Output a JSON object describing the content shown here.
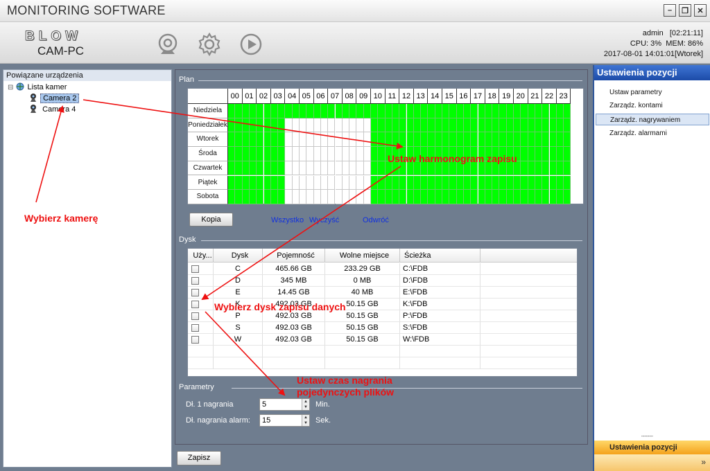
{
  "window": {
    "title": "MONITORING SOFTWARE",
    "minimize_label": "–",
    "restore_label": "❐",
    "close_label": "✕"
  },
  "header": {
    "brand": "BLOW",
    "product": "CAM-PC",
    "icons": [
      "camera-icon",
      "gear-icon",
      "play-icon"
    ],
    "user": "admin",
    "elapsed": "[02:21:11]",
    "cpu": "CPU:  3%",
    "mem": "MEM: 86%",
    "datetime": "2017-08-01 14:01:01[Wtorek]"
  },
  "tree": {
    "header": "Powiązane urządzenia",
    "root": "Lista kamer",
    "expander": "⊟",
    "cameras": [
      "Camera 2",
      "Camera 4"
    ],
    "selected_index": 0
  },
  "plan": {
    "label": "Plan",
    "hours": [
      "00",
      "01",
      "02",
      "03",
      "04",
      "05",
      "06",
      "07",
      "08",
      "09",
      "10",
      "11",
      "12",
      "13",
      "14",
      "15",
      "16",
      "17",
      "18",
      "19",
      "20",
      "21",
      "22",
      "23"
    ],
    "days": [
      "Niedziela",
      "Poniedziałek",
      "Wtorek",
      "Środa",
      "Czwartek",
      "Piątek",
      "Sobota"
    ],
    "schedule_note": "Each day: recording on for hours 00-03 and 10-23; Sunday all day",
    "copy_button": "Kopia",
    "links": {
      "all": "Wszystko",
      "clear": "Wyczyść",
      "invert": "Odwróć"
    }
  },
  "disk": {
    "label": "Dysk",
    "columns": [
      "Uży...",
      "Dysk",
      "Pojemność",
      "Wolne miejsce",
      "Ścieżka"
    ],
    "rows": [
      {
        "drive": "C",
        "capacity": "465.66 GB",
        "free": "233.29 GB",
        "path": "C:\\FDB"
      },
      {
        "drive": "D",
        "capacity": "345 MB",
        "free": "0 MB",
        "path": "D:\\FDB"
      },
      {
        "drive": "E",
        "capacity": "14.45 GB",
        "free": "40 MB",
        "path": "E:\\FDB"
      },
      {
        "drive": "K",
        "capacity": "492.03 GB",
        "free": "50.15 GB",
        "path": "K:\\FDB"
      },
      {
        "drive": "P",
        "capacity": "492.03 GB",
        "free": "50.15 GB",
        "path": "P:\\FDB"
      },
      {
        "drive": "S",
        "capacity": "492.03 GB",
        "free": "50.15 GB",
        "path": "S:\\FDB"
      },
      {
        "drive": "W",
        "capacity": "492.03 GB",
        "free": "50.15 GB",
        "path": "W:\\FDB"
      }
    ]
  },
  "params": {
    "label": "Parametry",
    "record_len_label": "Dł. 1 nagrania",
    "record_len_value": "5",
    "record_len_unit": "Min.",
    "alarm_len_label": "Dł. nagrania alarm:",
    "alarm_len_value": "15",
    "alarm_len_unit": "Sek."
  },
  "save_button": "Zapisz",
  "right_panel": {
    "title": "Ustawienia pozycji",
    "items": [
      "Ustaw parametry",
      "Zarządz. kontami",
      "Zarządz. nagrywaniem",
      "Zarządz. alarmami"
    ],
    "active_index": 2,
    "footer": "Ustawienia pozycji",
    "grip": "┅┅┅┅",
    "chevron": "»"
  },
  "annotations": {
    "select_camera": "Wybierz kamerę",
    "set_schedule": "Ustaw harmonogram zapisu",
    "select_disk": "Wybierz dysk zapisu danych",
    "set_time_line1": "Ustaw czas nagrania",
    "set_time_line2": "pojedynczych plików"
  },
  "colors": {
    "schedule_on": "#00ff00",
    "annotation": "#ee1111",
    "link": "#1030e0",
    "right_header": "#2a5cc0"
  }
}
